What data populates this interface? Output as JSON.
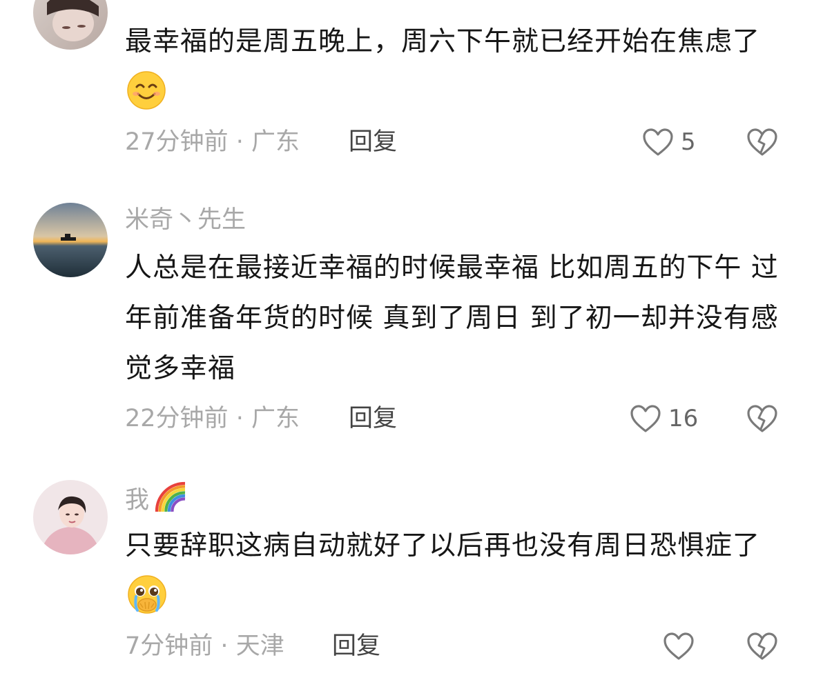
{
  "comments": [
    {
      "username": "",
      "text": "最幸福的是周五晚上，周六下午就已经开始在焦虑了",
      "emoji": "smiling-face-emoji",
      "time": "27分钟前",
      "separator": "·",
      "location": "广东",
      "reply_label": "回复",
      "likes": "5"
    },
    {
      "username": "米奇丶先生",
      "text": "人总是在最接近幸福的时候最幸福 比如周五的下午 过年前准备年货的时候 真到了周日 到了初一却并没有感觉多幸福",
      "time": "22分钟前",
      "separator": "·",
      "location": "广东",
      "reply_label": "回复",
      "likes": "16"
    },
    {
      "username": "我",
      "text": "只要辞职这病自动就好了以后再也没有周日恐惧症了",
      "emoji": "pleading-tears-emoji",
      "time": "7分钟前",
      "separator": "·",
      "location": "天津",
      "reply_label": "回复",
      "likes": ""
    }
  ],
  "icons": {
    "like": "heart-outline-icon",
    "dislike": "broken-heart-icon"
  },
  "colors": {
    "meta": "#a8a8a8",
    "text": "#161616",
    "icon": "#7a7a7a"
  }
}
